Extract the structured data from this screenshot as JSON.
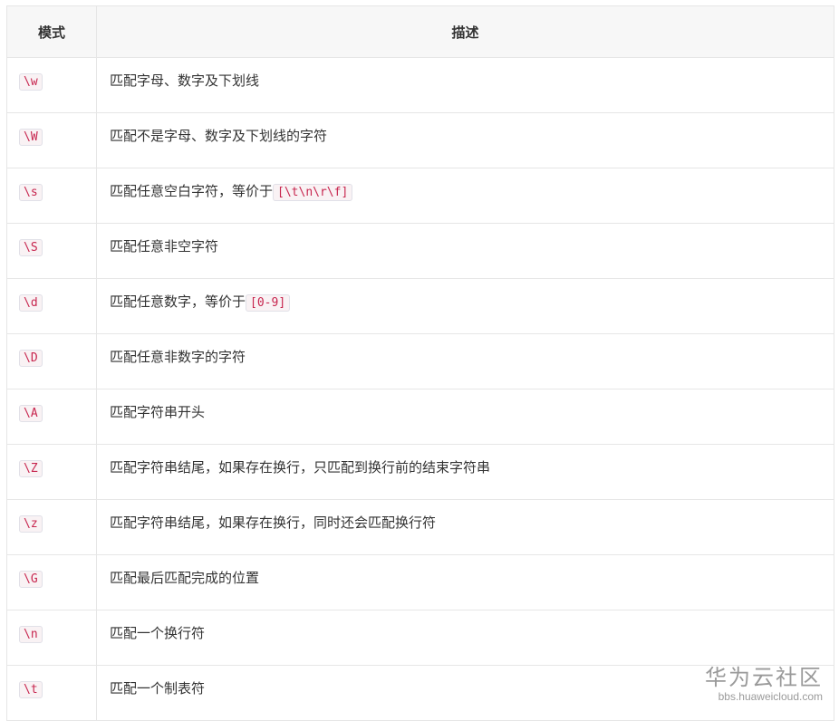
{
  "table": {
    "headers": {
      "pattern": "模式",
      "description": "描述"
    },
    "rows": [
      {
        "pattern": "\\w",
        "desc": "匹配字母、数字及下划线",
        "code": ""
      },
      {
        "pattern": "\\W",
        "desc": "匹配不是字母、数字及下划线的字符",
        "code": ""
      },
      {
        "pattern": "\\s",
        "desc": "匹配任意空白字符，等价于",
        "code": "[\\t\\n\\r\\f]"
      },
      {
        "pattern": "\\S",
        "desc": "匹配任意非空字符",
        "code": ""
      },
      {
        "pattern": "\\d",
        "desc": "匹配任意数字，等价于",
        "code": "[0-9]"
      },
      {
        "pattern": "\\D",
        "desc": "匹配任意非数字的字符",
        "code": ""
      },
      {
        "pattern": "\\A",
        "desc": "匹配字符串开头",
        "code": ""
      },
      {
        "pattern": "\\Z",
        "desc": "匹配字符串结尾，如果存在换行，只匹配到换行前的结束字符串",
        "code": ""
      },
      {
        "pattern": "\\z",
        "desc": "匹配字符串结尾，如果存在换行，同时还会匹配换行符",
        "code": ""
      },
      {
        "pattern": "\\G",
        "desc": "匹配最后匹配完成的位置",
        "code": ""
      },
      {
        "pattern": "\\n",
        "desc": "匹配一个换行符",
        "code": ""
      },
      {
        "pattern": "\\t",
        "desc": "匹配一个制表符",
        "code": ""
      }
    ]
  },
  "watermark": {
    "title": "华为云社区",
    "url": "bbs.huaweicloud.com"
  }
}
